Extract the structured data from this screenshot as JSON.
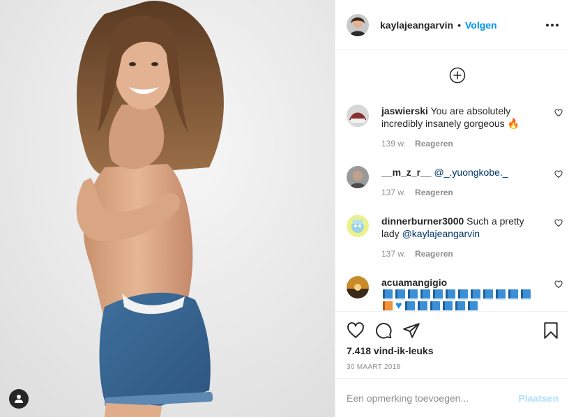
{
  "post": {
    "image_alt": "Photo of a smiling woman with long wavy hair in denim shorts against a light background"
  },
  "header": {
    "username": "kaylajeangarvin",
    "separator": "•",
    "follow_label": "Volgen",
    "more_icon": "more-horizontal-icon"
  },
  "comments": [
    {
      "username": "jaswierski",
      "text": "You are absolutely incredibly insanely gorgeous 🔥",
      "time": "139 w.",
      "reply": "Reageren",
      "avatar_color": "#8a2f2f"
    },
    {
      "username": "__m_z_r__",
      "mention": "@_.yuongkobe._",
      "time": "137 w.",
      "reply": "Reageren",
      "avatar_color": "#5a5a5a"
    },
    {
      "username": "dinnerburner3000",
      "text": "Such a pretty lady",
      "mention": "@kaylajeangarvin",
      "time": "137 w.",
      "reply": "Reageren",
      "avatar_color": "#d9e36a"
    },
    {
      "username": "acuamangigio",
      "avatar_color": "#c98a2a",
      "emojis": [
        "book",
        "book",
        "book",
        "book",
        "book",
        "book",
        "book",
        "book",
        "book",
        "book",
        "book",
        "book",
        "orange-book",
        "blue-heart",
        "book",
        "book",
        "book",
        "book",
        "book",
        "book"
      ]
    }
  ],
  "actions": {
    "likes": "7.418 vind-ik-leuks",
    "date": "30 MAART 2018"
  },
  "add_comment": {
    "placeholder": "Een opmerking toevoegen...",
    "post_label": "Plaatsen"
  },
  "colors": {
    "link": "#0095f6",
    "mention": "#00376b",
    "muted": "#8e8e8e",
    "post_disabled": "#b2dffc"
  }
}
